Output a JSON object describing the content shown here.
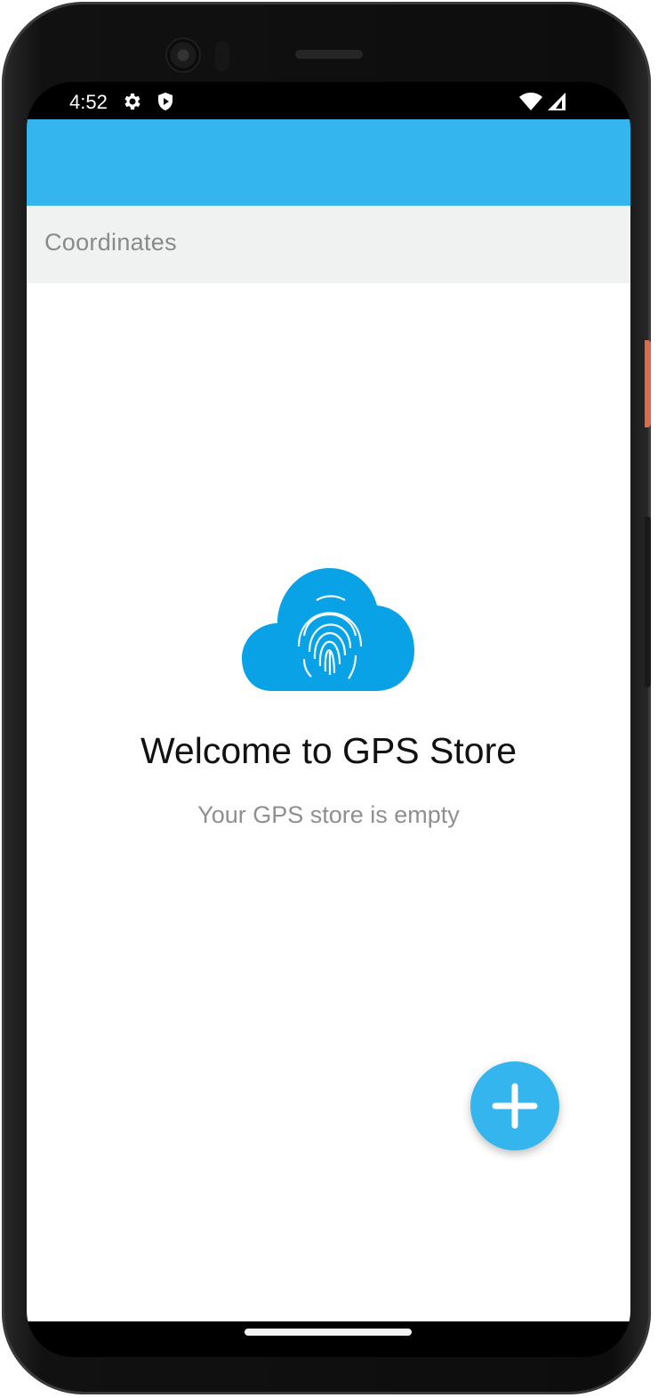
{
  "status_bar": {
    "time": "4:52",
    "icons_left": [
      "settings-icon",
      "shield-icon"
    ],
    "icons_right": [
      "wifi-icon",
      "signal-icon"
    ]
  },
  "app_bar": {
    "color": "#35b5ee"
  },
  "section": {
    "title": "Coordinates"
  },
  "empty_state": {
    "icon": "cloud-fingerprint-icon",
    "title": "Welcome to GPS Store",
    "subtitle": "Your GPS store is empty"
  },
  "fab": {
    "icon": "plus-icon",
    "color": "#35b5ee"
  },
  "colors": {
    "accent": "#35b5ee",
    "header_bg": "#f0f1f1",
    "muted_text": "#8a8a8a"
  }
}
